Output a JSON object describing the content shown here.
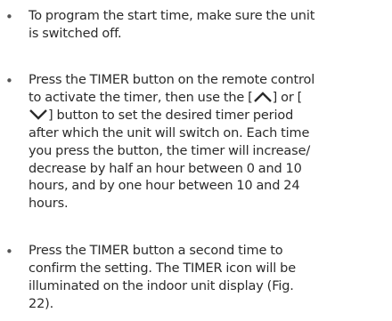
{
  "bullet_char": "•",
  "items": [
    {
      "lines": [
        "To program the start time, make sure the unit",
        "is switched off."
      ]
    },
    {
      "lines": {
        "l0": "Press the TIMER button on the remote control",
        "l1_a": "to activate the timer, then use the [",
        "l1_b": "] or [",
        "l2_b": "] button to set the desired timer period",
        "l3": "after which the unit will switch on. Each time",
        "l4": "you press the button, the timer will increase/",
        "l5": "decrease by half an hour between 0 and 10",
        "l6": "hours, and by one hour between 10 and 24",
        "l7": "hours."
      },
      "icons": [
        "up-arrow-icon",
        "down-arrow-icon"
      ]
    },
    {
      "lines": [
        "Press the TIMER button a second time to",
        "confirm the setting. The TIMER icon will be",
        "illuminated on the indoor unit display (Fig.",
        "22)."
      ]
    }
  ]
}
